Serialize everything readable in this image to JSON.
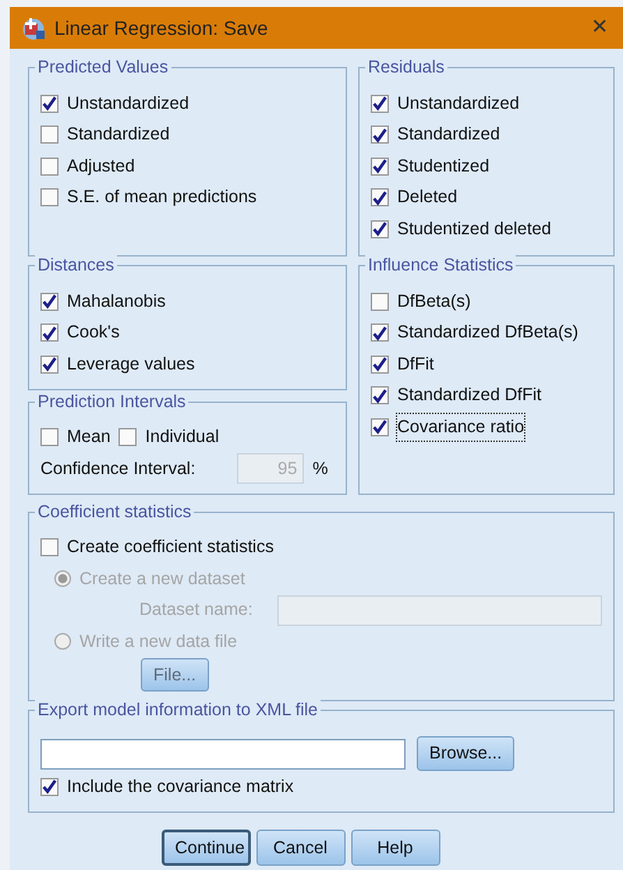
{
  "window": {
    "title": "Linear Regression: Save",
    "close": "✕"
  },
  "predicted_values": {
    "title": "Predicted Values",
    "items": [
      {
        "label": "Unstandardized",
        "checked": true
      },
      {
        "label": "Standardized",
        "checked": false
      },
      {
        "label": "Adjusted",
        "checked": false
      },
      {
        "label": "S.E. of mean predictions",
        "checked": false
      }
    ]
  },
  "residuals": {
    "title": "Residuals",
    "items": [
      {
        "label": "Unstandardized",
        "checked": true
      },
      {
        "label": "Standardized",
        "checked": true
      },
      {
        "label": "Studentized",
        "checked": true
      },
      {
        "label": "Deleted",
        "checked": true
      },
      {
        "label": "Studentized deleted",
        "checked": true
      }
    ]
  },
  "distances": {
    "title": "Distances",
    "items": [
      {
        "label": "Mahalanobis",
        "checked": true
      },
      {
        "label": "Cook's",
        "checked": true
      },
      {
        "label": "Leverage values",
        "checked": true
      }
    ]
  },
  "prediction_intervals": {
    "title": "Prediction Intervals",
    "items": [
      {
        "label": "Mean",
        "checked": false
      },
      {
        "label": "Individual",
        "checked": false
      }
    ],
    "confidence_label": "Confidence Interval:",
    "confidence_value": "95",
    "unit": "%",
    "disabled": true
  },
  "influence_statistics": {
    "title": "Influence Statistics",
    "items": [
      {
        "label": "DfBeta(s)",
        "checked": false,
        "focused": false
      },
      {
        "label": "Standardized DfBeta(s)",
        "checked": true,
        "focused": false
      },
      {
        "label": "DfFit",
        "checked": true,
        "focused": false
      },
      {
        "label": "Standardized DfFit",
        "checked": true,
        "focused": false
      },
      {
        "label": "Covariance ratio",
        "checked": true,
        "focused": true
      }
    ]
  },
  "coefficient_statistics": {
    "title": "Coefficient statistics",
    "checkbox": {
      "label": "Create coefficient statistics",
      "checked": false
    },
    "options": [
      {
        "label": "Create a new dataset",
        "selected": true,
        "disabled": true
      },
      {
        "label": "Write a new data file",
        "selected": false,
        "disabled": true
      }
    ],
    "dataset_label": "Dataset name:",
    "file_button": "File..."
  },
  "export": {
    "title": "Export model information to XML file",
    "browse_button": "Browse...",
    "checkbox": {
      "label": "Include the covariance matrix",
      "checked": true
    }
  },
  "buttons": [
    {
      "label": "Continue",
      "default": true
    },
    {
      "label": "Cancel",
      "default": false
    },
    {
      "label": "Help",
      "default": false
    }
  ]
}
